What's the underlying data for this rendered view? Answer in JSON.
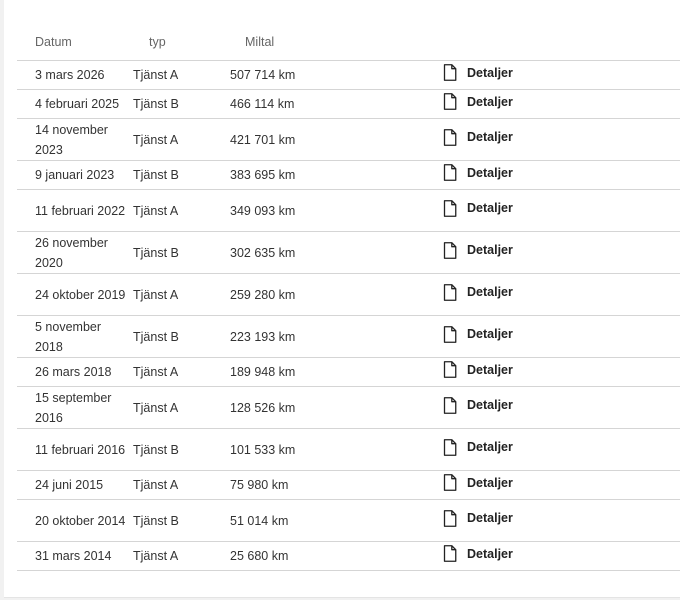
{
  "table": {
    "headers": {
      "date": "Datum",
      "type": "typ",
      "mileage": "Miltal",
      "action": ""
    },
    "rows": [
      {
        "date": "3 mars 2026",
        "type": "Tjänst A",
        "mileage": "507 714 km",
        "action": "Detaljer"
      },
      {
        "date": "4 februari 2025",
        "type": "Tjänst B",
        "mileage": "466 114 km",
        "action": "Detaljer"
      },
      {
        "date": "14 november 2023",
        "type": "Tjänst A",
        "mileage": "421 701 km",
        "action": "Detaljer"
      },
      {
        "date": "9 januari 2023",
        "type": "Tjänst B",
        "mileage": "383 695 km",
        "action": "Detaljer"
      },
      {
        "date": "11 februari 2022",
        "type": "Tjänst A",
        "mileage": "349 093 km",
        "action": "Detaljer"
      },
      {
        "date": "26 november 2020",
        "type": "Tjänst B",
        "mileage": "302 635 km",
        "action": "Detaljer"
      },
      {
        "date": "24 oktober 2019",
        "type": "Tjänst A",
        "mileage": "259 280 km",
        "action": "Detaljer"
      },
      {
        "date": "5 november 2018",
        "type": "Tjänst B",
        "mileage": "223 193 km",
        "action": "Detaljer"
      },
      {
        "date": "26 mars 2018",
        "type": "Tjänst A",
        "mileage": "189 948 km",
        "action": "Detaljer"
      },
      {
        "date": "15 september 2016",
        "type": "Tjänst A",
        "mileage": "128 526 km",
        "action": "Detaljer"
      },
      {
        "date": "11 februari 2016",
        "type": "Tjänst B",
        "mileage": "101 533 km",
        "action": "Detaljer"
      },
      {
        "date": "24 juni 2015",
        "type": "Tjänst A",
        "mileage": "75 980 km",
        "action": "Detaljer"
      },
      {
        "date": "20 oktober 2014",
        "type": "Tjänst B",
        "mileage": "51 014 km",
        "action": "Detaljer"
      },
      {
        "date": "31 mars 2014",
        "type": "Tjänst A",
        "mileage": "25 680 km",
        "action": "Detaljer"
      }
    ]
  },
  "icons": {
    "details": "document-icon"
  },
  "colors": {
    "background": "#f1f1f1",
    "panel": "#ffffff",
    "divider": "#d5d5d5",
    "header_text": "#666666",
    "body_text": "#333333"
  }
}
